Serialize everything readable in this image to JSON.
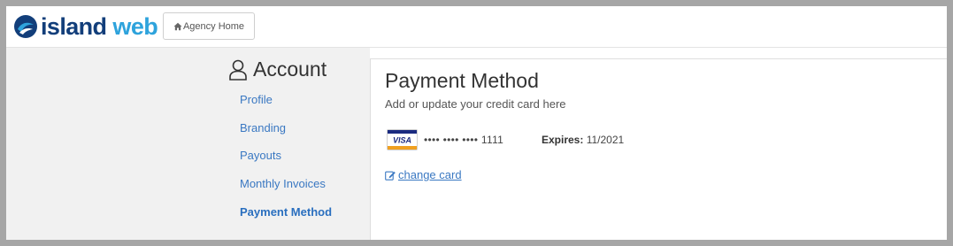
{
  "header": {
    "logo_part1": "island",
    "logo_part2": "web",
    "agency_home_label": "Agency Home"
  },
  "sidebar": {
    "title": "Account",
    "items": [
      {
        "label": "Profile"
      },
      {
        "label": "Branding"
      },
      {
        "label": "Payouts"
      },
      {
        "label": "Monthly Invoices"
      },
      {
        "label": "Payment Method",
        "active": true
      }
    ]
  },
  "main": {
    "title": "Payment Method",
    "subtitle": "Add or update your credit card here",
    "card": {
      "brand": "VISA",
      "masked_number": "•••• •••• •••• 1111",
      "expires_label": "Expires:",
      "expires_value": "11/2021"
    },
    "change_card_label": "change card"
  },
  "colors": {
    "link": "#3a78c2",
    "logo_dark": "#123e7a",
    "logo_light": "#2ea3dc",
    "sidebar_bg": "#f1f1f1"
  },
  "icons": [
    "island-web-logo-icon",
    "home-icon",
    "user-icon",
    "visa-card-icon",
    "edit-icon"
  ]
}
